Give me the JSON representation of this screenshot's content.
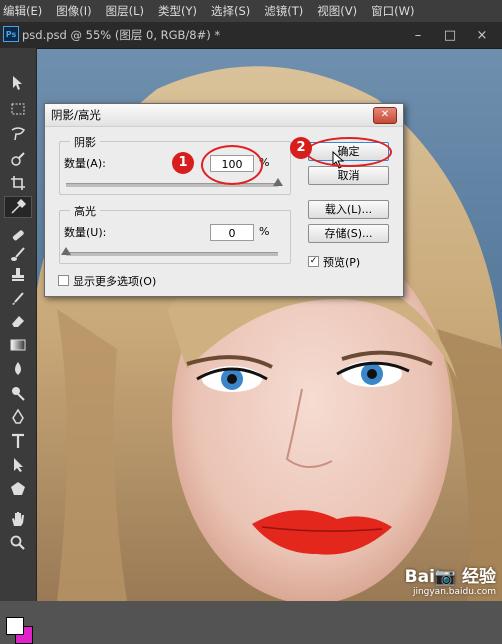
{
  "menu": [
    "编辑(E)",
    "图像(I)",
    "图层(L)",
    "类型(Y)",
    "选择(S)",
    "滤镜(T)",
    "视图(V)",
    "窗口(W)"
  ],
  "tab": {
    "logo": "Ps",
    "title": "psd.psd @ 55% (图层 0, RGB/8#) *"
  },
  "window_buttons": [
    "–",
    "□",
    "×"
  ],
  "dialog": {
    "title": "阴影/高光",
    "close": "✕",
    "shadows": {
      "title": "阴影",
      "amount_label": "数量(A):",
      "amount_value": "100",
      "unit": "%",
      "slider_fraction": 1.0
    },
    "highlights": {
      "title": "高光",
      "amount_label": "数量(U):",
      "amount_value": "0",
      "unit": "%",
      "slider_fraction": 0.0
    },
    "more_options": "显示更多选项(O)",
    "buttons": {
      "ok": "确定",
      "cancel": "取消",
      "load": "载入(L)...",
      "save": "存储(S)..."
    },
    "preview": {
      "label": "预览(P)",
      "checked": true
    }
  },
  "annotations": [
    "1",
    "2"
  ],
  "watermark": {
    "brand": "Bai📷 经验",
    "url": "jingyan.baidu.com"
  },
  "colors": {
    "foreground": "#ffffff",
    "background": "#e020c8",
    "annotation": "#d81d1d"
  }
}
